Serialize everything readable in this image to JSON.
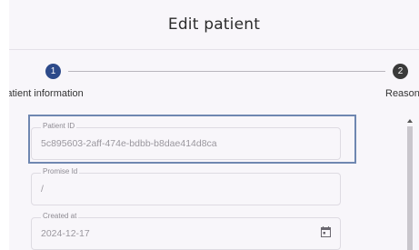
{
  "dialog": {
    "title": "Edit patient"
  },
  "stepper": {
    "steps": [
      {
        "number": "1",
        "label": "Patient information"
      },
      {
        "number": "2",
        "label": "Reason"
      }
    ]
  },
  "form": {
    "fields": [
      {
        "label": "Patient ID",
        "value": "5c895603-2aff-474e-bdbb-b8dae414d8ca"
      },
      {
        "label": "Promise Id",
        "value": "/"
      },
      {
        "label": "Created at",
        "value": "2024-12-17"
      }
    ]
  },
  "colors": {
    "active_step": "#2d4a8a",
    "inactive_step": "#3a3a3a",
    "highlight": "#6f87b1"
  }
}
